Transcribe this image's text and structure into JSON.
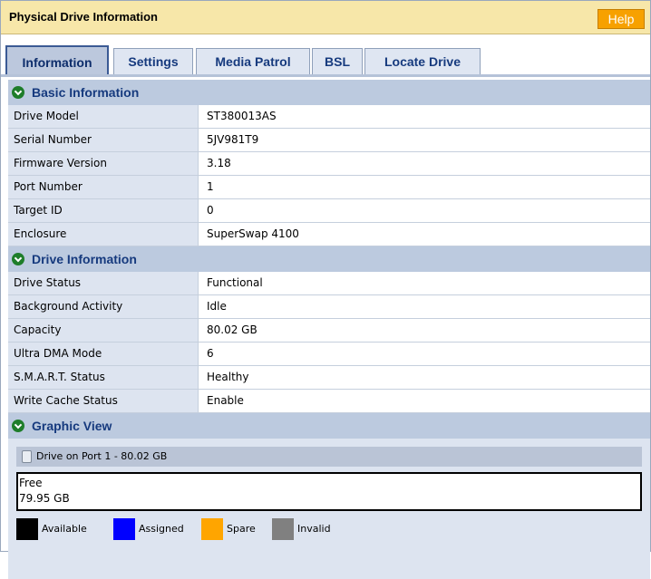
{
  "window": {
    "title": "Physical Drive Information",
    "help_label": "Help"
  },
  "tabs": [
    {
      "label": "Information",
      "active": true
    },
    {
      "label": "Settings",
      "active": false
    },
    {
      "label": "Media Patrol",
      "active": false
    },
    {
      "label": "BSL",
      "active": false
    },
    {
      "label": "Locate Drive",
      "active": false
    }
  ],
  "basic_info": {
    "title": "Basic Information",
    "rows": [
      {
        "label": "Drive Model",
        "value": "ST380013AS"
      },
      {
        "label": "Serial Number",
        "value": "5JV981T9"
      },
      {
        "label": "Firmware Version",
        "value": "3.18"
      },
      {
        "label": "Port Number",
        "value": "1"
      },
      {
        "label": "Target ID",
        "value": "0"
      },
      {
        "label": "Enclosure",
        "value": "SuperSwap 4100"
      }
    ]
  },
  "drive_info": {
    "title": "Drive Information",
    "rows": [
      {
        "label": "Drive Status",
        "value": "Functional"
      },
      {
        "label": "Background Activity",
        "value": "Idle"
      },
      {
        "label": "Capacity",
        "value": "80.02 GB"
      },
      {
        "label": "Ultra DMA Mode",
        "value": "6"
      },
      {
        "label": "S.M.A.R.T. Status",
        "value": "Healthy"
      },
      {
        "label": "Write Cache Status",
        "value": "Enable"
      }
    ]
  },
  "graphic_view": {
    "title": "Graphic View",
    "drive_label": "Drive on Port 1 - 80.02 GB",
    "free_label": "Free",
    "free_size": "79.95 GB",
    "legend": [
      {
        "label": "Available",
        "color": "#000000"
      },
      {
        "label": "Assigned",
        "color": "#0000ff"
      },
      {
        "label": "Spare",
        "color": "#ffa500"
      },
      {
        "label": "Invalid",
        "color": "#808080"
      }
    ]
  },
  "colors": {
    "title_bar": "#f7e7a9",
    "help_button": "#f7a100",
    "section_header": "#bccadf",
    "label_cell": "#dde4f0",
    "header_icon": "#1e7d2a"
  }
}
